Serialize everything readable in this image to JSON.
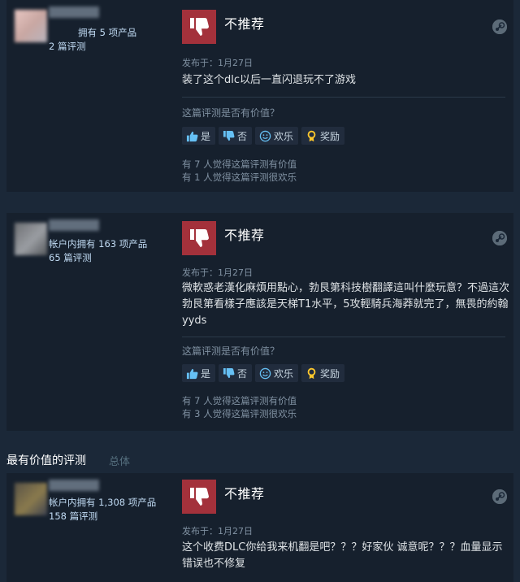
{
  "reviews": [
    {
      "author": {
        "owned": "拥有 5 项产品",
        "reviews": "2 篇评测"
      },
      "verdict": "不推荐",
      "posted": "发布于：1月27日",
      "text": "装了这个dlc以后一直闪退玩不了游戏",
      "helpful_question": "这篇评测是否有价值？",
      "buttons": {
        "yes": "是",
        "no": "否",
        "funny": "欢乐",
        "award": "奖励"
      },
      "helpful_stat": "有 7 人觉得这篇评测有价值",
      "funny_stat": "有 1 人觉得这篇评测很欢乐"
    },
    {
      "author": {
        "owned": "帐户内拥有 163 项产品",
        "reviews": "65 篇评测"
      },
      "verdict": "不推荐",
      "posted": "发布于：1月27日",
      "text": "微軟惑老漢化麻煩用點心，勃艮第科技樹翻譯這叫什麼玩意？不過這次勃艮第看樣子應該是天梯T1水平，5攻輕騎兵海莽就完了，無畏的約翰yyds",
      "helpful_question": "这篇评测是否有价值？",
      "buttons": {
        "yes": "是",
        "no": "否",
        "funny": "欢乐",
        "award": "奖励"
      },
      "helpful_stat": "有 7 人觉得这篇评测有价值",
      "funny_stat": "有 3 人觉得这篇评测很欢乐"
    },
    {
      "author": {
        "owned": "帐户内拥有 1,308 项产品",
        "reviews": "158 篇评测"
      },
      "verdict": "不推荐",
      "posted": "发布于：1月27日",
      "text": "这个收费DLC你给我来机翻是吧？？？好家伙 诚意呢？？？血量显示错误也不修复"
    }
  ],
  "section": {
    "title": "最有价值的评测",
    "tab": "总体"
  },
  "colors": {
    "background": "#1b2838",
    "card": "#16202d",
    "thumb_down": "#a3313b",
    "award": "#ffc82c"
  },
  "icons": [
    "thumbs-down-icon",
    "steam-icon",
    "thumbs-up-icon",
    "smiley-icon",
    "award-icon"
  ]
}
